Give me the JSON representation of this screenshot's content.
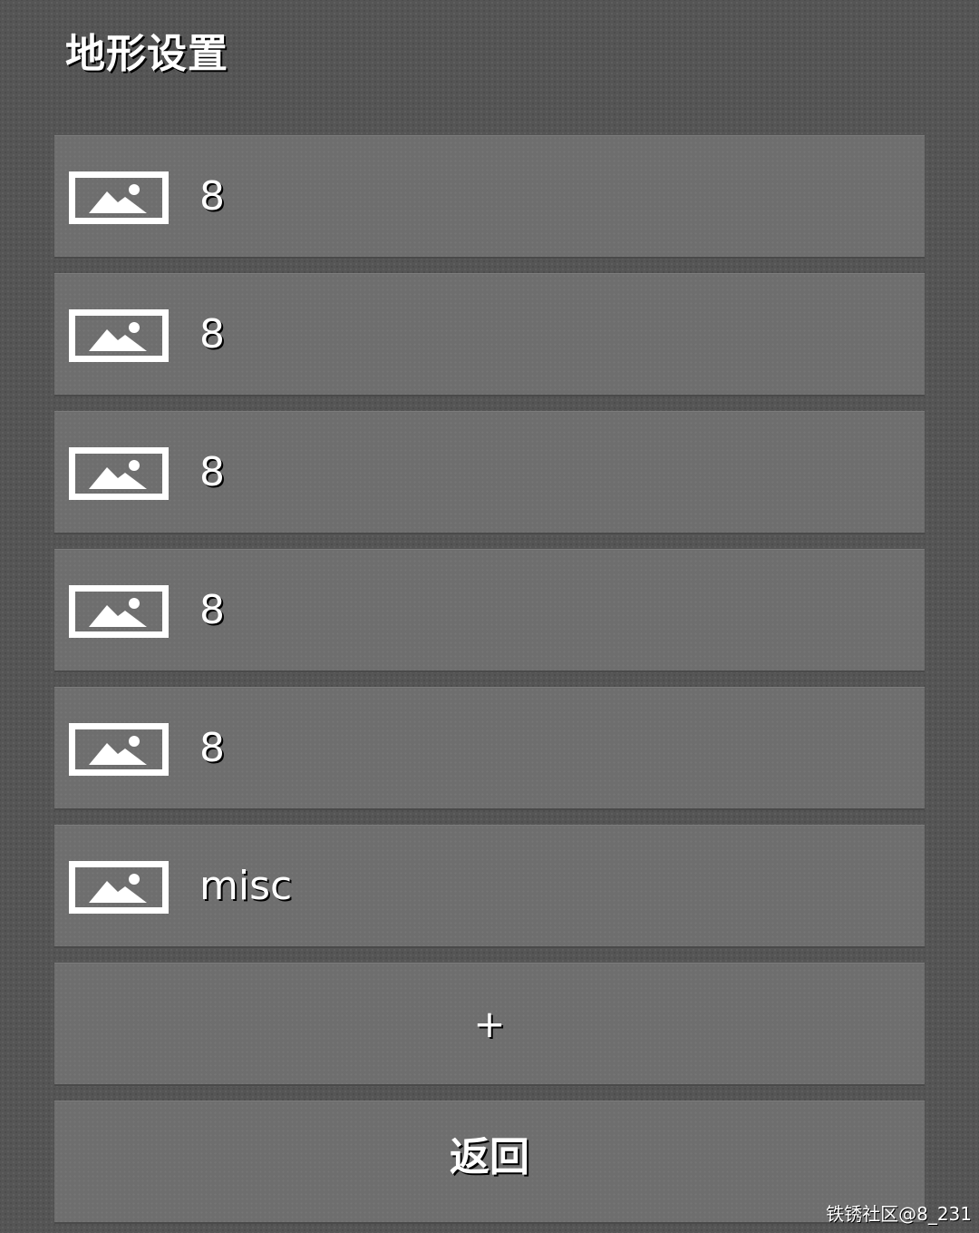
{
  "title": "地形设置",
  "items": [
    {
      "label": "8",
      "icon": "image-icon"
    },
    {
      "label": "8",
      "icon": "image-icon"
    },
    {
      "label": "8",
      "icon": "image-icon"
    },
    {
      "label": "8",
      "icon": "image-icon"
    },
    {
      "label": "8",
      "icon": "image-icon"
    },
    {
      "label": "misc",
      "icon": "image-icon"
    }
  ],
  "add_label": "+",
  "back_label": "返回",
  "watermark": "铁锈社区@8_231",
  "colors": {
    "background": "#555555",
    "button": "#6e6e6e",
    "text": "#ffffff"
  }
}
